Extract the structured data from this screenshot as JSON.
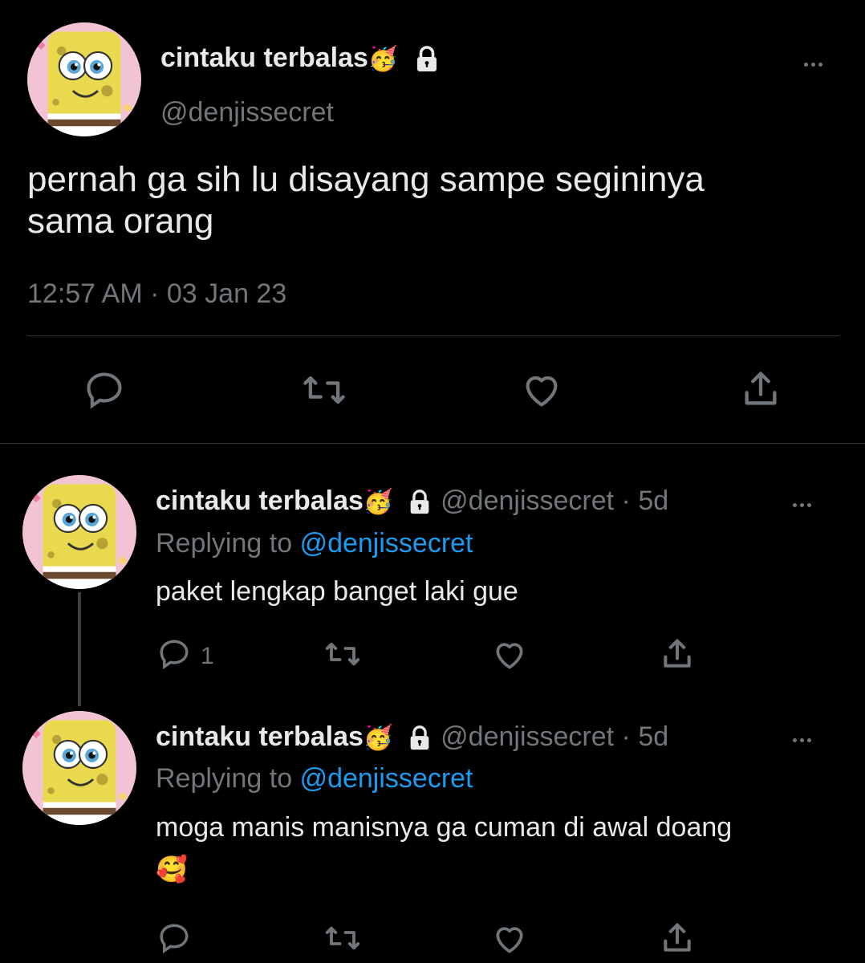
{
  "main_tweet": {
    "display_name": "cintaku terbalas",
    "name_emoji": "🥳",
    "handle": "@denjissecret",
    "text_line1": "pernah ga sih lu disayang sampe segininya",
    "text_line2": "sama orang",
    "time": "12:57 AM",
    "separator": "·",
    "date": "03 Jan 23"
  },
  "replies": [
    {
      "display_name": "cintaku terbalas",
      "name_emoji": "🥳",
      "handle": "@denjissecret",
      "age": "· 5d",
      "replying_prefix": "Replying to",
      "replying_handle": "@denjissecret",
      "text": "paket lengkap banget laki gue",
      "reply_count": "1"
    },
    {
      "display_name": "cintaku terbalas",
      "name_emoji": "🥳",
      "handle": "@denjissecret",
      "age": "· 5d",
      "replying_prefix": "Replying to",
      "replying_handle": "@denjissecret",
      "text": "moga manis manisnya ga cuman di awal doang",
      "text_emoji": "🥰",
      "reply_count": ""
    }
  ],
  "icons": {
    "reply": "reply-icon",
    "retweet": "retweet-icon",
    "like": "heart-icon",
    "share": "share-icon",
    "more": "more-icon",
    "lock": "lock-icon"
  },
  "colors": {
    "background": "#000000",
    "text": "#e7e9ea",
    "muted": "#71767b",
    "link": "#1d9bf0",
    "divider": "#2f3336"
  }
}
